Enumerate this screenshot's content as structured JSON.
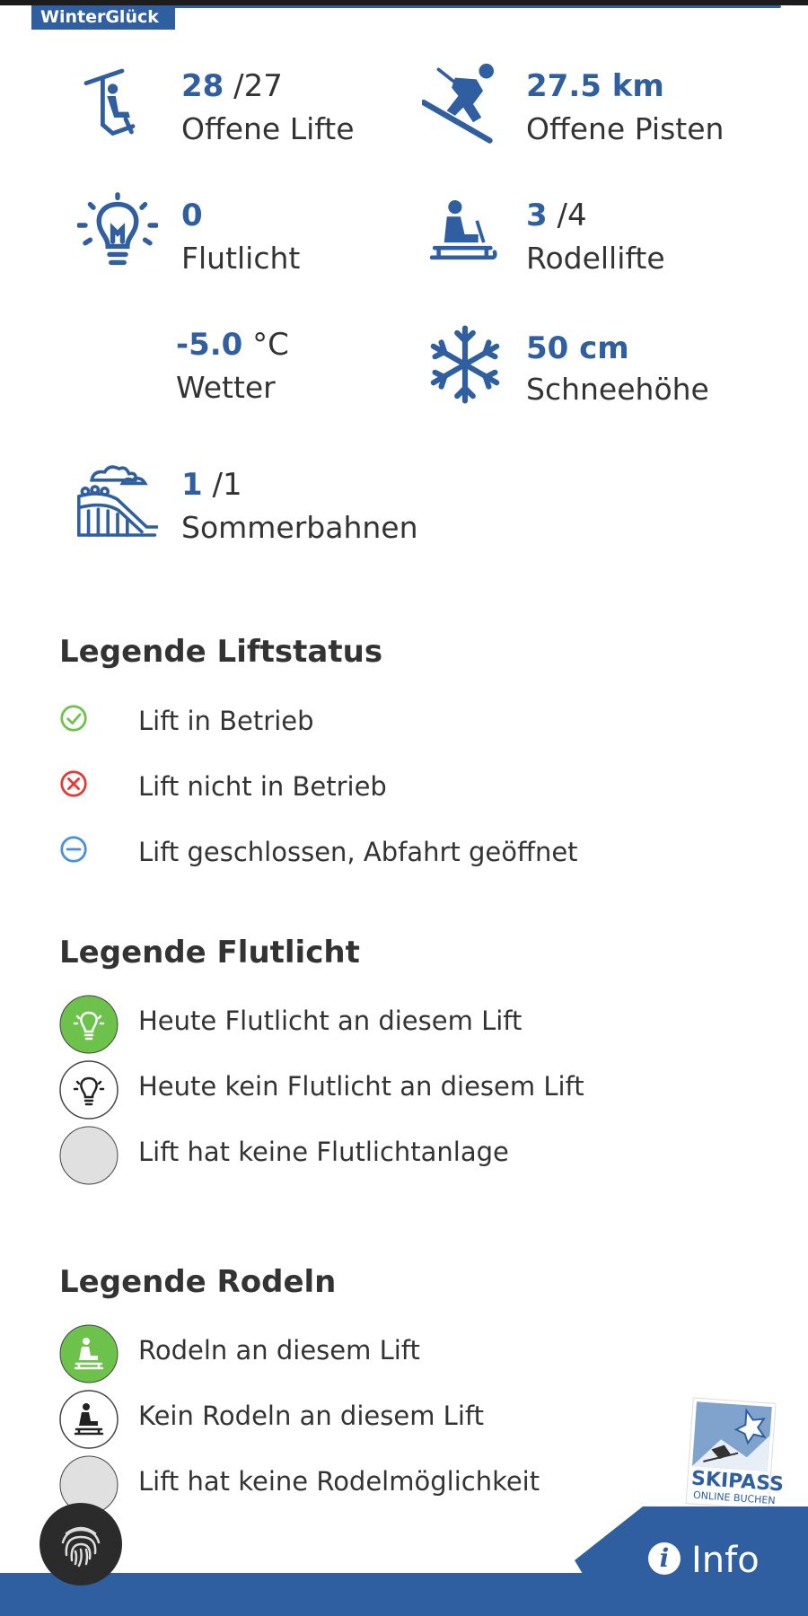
{
  "brand": "WinterGlück",
  "stats": {
    "lifts": {
      "value": "28",
      "total": "/27",
      "label": "Offene Lifte",
      "icon": "chairlift-icon"
    },
    "pistes": {
      "value": "27.5 km",
      "label": "Offene Pisten",
      "icon": "skier-icon"
    },
    "floodlight": {
      "value": "0",
      "label": "Flutlicht",
      "icon": "lightbulb-icon"
    },
    "sled_lifts": {
      "value": "3",
      "total": "/4",
      "label": "Rodellifte",
      "icon": "sled-icon"
    },
    "weather": {
      "value": "-5.0",
      "unit": "°C",
      "label": "Wetter"
    },
    "snow": {
      "value": "50 cm",
      "label": "Schneehöhe",
      "icon": "snowflake-icon"
    },
    "summer": {
      "value": "1",
      "total": "/1",
      "label": "Sommerbahnen",
      "icon": "summer-coaster-icon"
    }
  },
  "legend_lift": {
    "title": "Legende Liftstatus",
    "items": [
      {
        "label": "Lift in Betrieb",
        "color": "#6cc24a"
      },
      {
        "label": "Lift nicht in Betrieb",
        "color": "#e53935"
      },
      {
        "label": "Lift geschlossen, Abfahrt geöffnet",
        "color": "#4a90d9"
      }
    ]
  },
  "legend_flood": {
    "title": "Legende Flutlicht",
    "items": [
      {
        "label": "Heute Flutlicht an diesem Lift"
      },
      {
        "label": "Heute kein Flutlicht an diesem Lift"
      },
      {
        "label": "Lift hat keine Flutlichtanlage"
      }
    ]
  },
  "legend_sled": {
    "title": "Legende Rodeln",
    "items": [
      {
        "label": "Rodeln an diesem Lift"
      },
      {
        "label": "Kein Rodeln an diesem Lift"
      },
      {
        "label": "Lift hat keine Rodelmöglichkeit"
      }
    ]
  },
  "skipass": {
    "line1": "SKIPASS",
    "line2": "ONLINE BUCHEN"
  },
  "info": {
    "label": "Info"
  },
  "colors": {
    "brand_blue": "#2f5fa0",
    "green": "#6cc24a",
    "red": "#e53935",
    "blue": "#4a90d9",
    "grey": "#e0e0e0"
  }
}
